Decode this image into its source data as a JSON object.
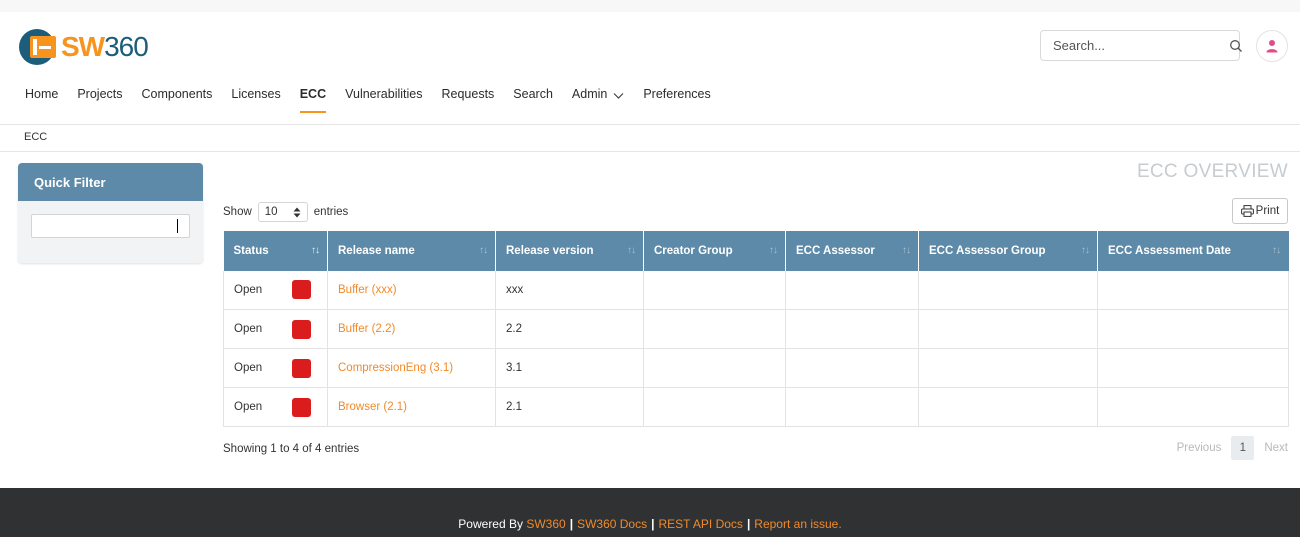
{
  "app": {
    "logo_sw": "SW",
    "logo_num": "360",
    "colors": {
      "accent": "#f7941e",
      "header_blue": "#5d8aa8",
      "status_red": "#db1c1c",
      "link_orange": "#f28a2a",
      "footer_bg": "#2f3132"
    }
  },
  "header": {
    "search_placeholder": "Search...",
    "search_icon": "search-icon",
    "avatar_icon": "user-icon"
  },
  "nav": {
    "items": [
      {
        "label": "Home"
      },
      {
        "label": "Projects"
      },
      {
        "label": "Components"
      },
      {
        "label": "Licenses"
      },
      {
        "label": "ECC",
        "active": true
      },
      {
        "label": "Vulnerabilities"
      },
      {
        "label": "Requests"
      },
      {
        "label": "Search"
      },
      {
        "label": "Admin",
        "has_dropdown": true
      },
      {
        "label": "Preferences"
      }
    ]
  },
  "breadcrumb": "ECC",
  "quick_filter": {
    "title": "Quick Filter",
    "value": ""
  },
  "page_title": "ECC OVERVIEW",
  "table_controls": {
    "show_label": "Show",
    "entries_value": "10",
    "entries_label": "entries",
    "print_label": "Print"
  },
  "table": {
    "columns": [
      "Status",
      "Release name",
      "Release version",
      "Creator Group",
      "ECC Assessor",
      "ECC Assessor Group",
      "ECC Assessment Date"
    ],
    "rows": [
      {
        "status": "Open",
        "release_name": "Buffer (xxx)",
        "release_version": "xxx",
        "creator_group": "",
        "ecc_assessor": "",
        "ecc_assessor_group": "",
        "ecc_assessment_date": ""
      },
      {
        "status": "Open",
        "release_name": "Buffer (2.2)",
        "release_version": "2.2",
        "creator_group": "",
        "ecc_assessor": "",
        "ecc_assessor_group": "",
        "ecc_assessment_date": ""
      },
      {
        "status": "Open",
        "release_name": "CompressionEng (3.1)",
        "release_version": "3.1",
        "creator_group": "",
        "ecc_assessor": "",
        "ecc_assessor_group": "",
        "ecc_assessment_date": ""
      },
      {
        "status": "Open",
        "release_name": "Browser (2.1)",
        "release_version": "2.1",
        "creator_group": "",
        "ecc_assessor": "",
        "ecc_assessor_group": "",
        "ecc_assessment_date": ""
      }
    ]
  },
  "pagination": {
    "info": "Showing 1 to 4 of 4 entries",
    "previous": "Previous",
    "current": "1",
    "next": "Next"
  },
  "footer": {
    "powered_by": "Powered By",
    "links": [
      "SW360",
      "SW360 Docs",
      "REST API Docs",
      "Report an issue."
    ]
  }
}
